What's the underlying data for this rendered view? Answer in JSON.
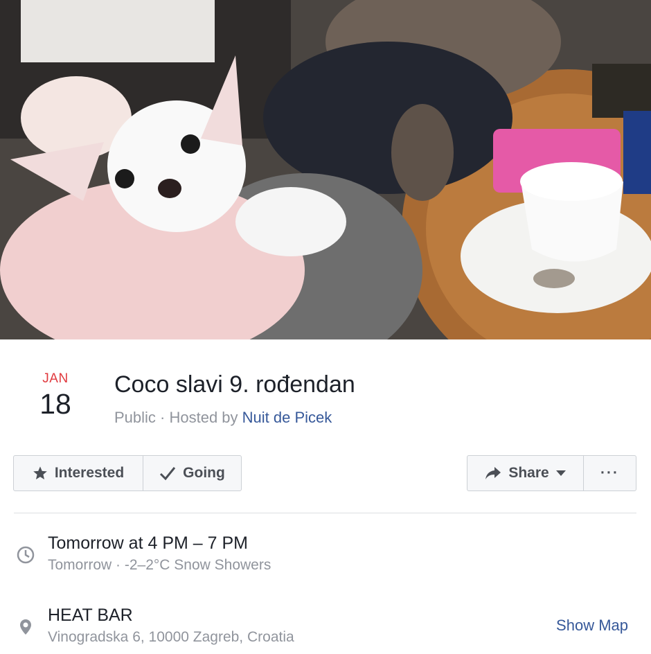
{
  "event": {
    "month": "JAN",
    "day": "18",
    "title": "Coco slavi 9. rođendan",
    "visibility": "Public",
    "hosted_by_prefix": "· Hosted by",
    "host": "Nuit de Picek"
  },
  "actions": {
    "interested_label": "Interested",
    "interested_icon": "star-icon",
    "going_label": "Going",
    "going_icon": "check-icon",
    "share_label": "Share",
    "share_icon": "share-arrow-icon",
    "more_label": "···"
  },
  "details": {
    "time_main": "Tomorrow at 4 PM – 7 PM",
    "time_sub": "Tomorrow · -2–2°C Snow Showers",
    "time_icon": "clock-icon",
    "place_main": "HEAT BAR",
    "place_sub": "Vinogradska 6, 10000 Zagreb, Croatia",
    "place_icon": "location-pin-icon",
    "show_map_label": "Show Map"
  },
  "colors": {
    "month_red": "#e0393e",
    "link_blue": "#365899",
    "muted_gray": "#90949c"
  }
}
